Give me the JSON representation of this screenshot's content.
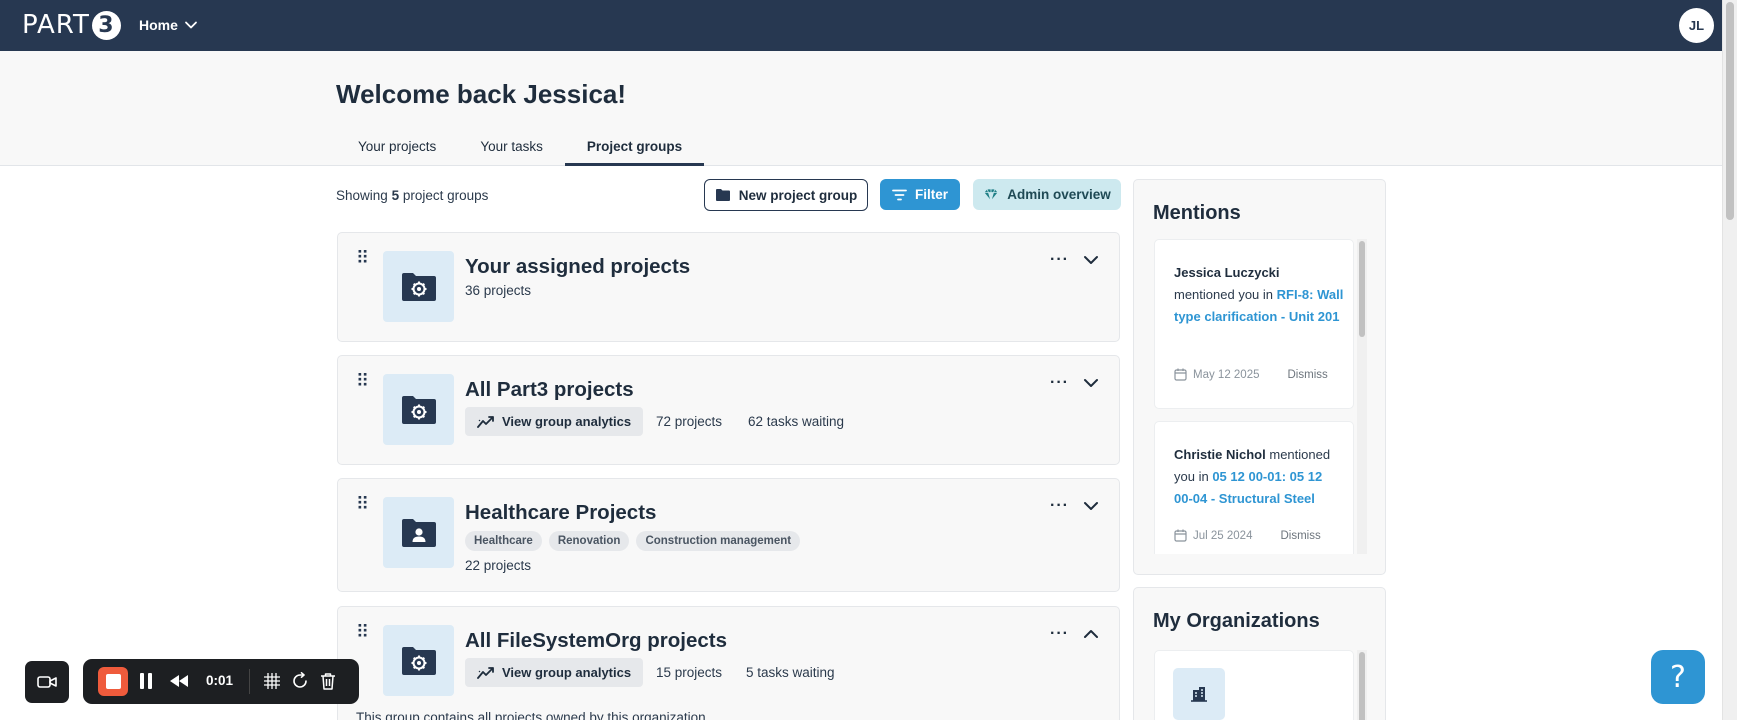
{
  "topbar": {
    "logo_text": "PART",
    "logo_digit": "3",
    "home_label": "Home",
    "avatar_initials": "JL"
  },
  "header": {
    "welcome": "Welcome back Jessica!",
    "tabs": [
      {
        "label": "Your projects",
        "active": false
      },
      {
        "label": "Your tasks",
        "active": false
      },
      {
        "label": "Project groups",
        "active": true
      }
    ]
  },
  "toolbar": {
    "showing_prefix": "Showing",
    "showing_count": "5",
    "showing_suffix": "project groups",
    "new_group_label": "New project group",
    "filter_label": "Filter",
    "admin_label": "Admin overview"
  },
  "groups": [
    {
      "title": "Your assigned projects",
      "projects": "36 projects"
    },
    {
      "title": "All Part3 projects",
      "analytics_label": "View group analytics",
      "projects": "72 projects",
      "tasks": "62 tasks waiting"
    },
    {
      "title": "Healthcare Projects",
      "tags": [
        "Healthcare",
        "Renovation",
        "Construction management"
      ],
      "projects": "22 projects"
    },
    {
      "title": "All FileSystemOrg projects",
      "analytics_label": "View group analytics",
      "projects": "15 projects",
      "tasks": "5 tasks waiting",
      "description": "This group contains all projects owned by this organization."
    }
  ],
  "mentions": {
    "title": "Mentions",
    "items": [
      {
        "who": "Jessica Luczycki",
        "verb": "mentioned you in",
        "link": "RFI-8: Wall type clarification - Unit 201",
        "date": "May 12 2025",
        "dismiss": "Dismiss"
      },
      {
        "who": "Christie Nichol",
        "verb": "mentioned you in",
        "link": "05 12 00-01: 05 12 00-04 - Structural Steel",
        "date": "Jul 25 2024",
        "dismiss": "Dismiss"
      }
    ]
  },
  "organizations": {
    "title": "My Organizations"
  },
  "help": {
    "label": "?"
  },
  "recorder": {
    "time": "0:01"
  },
  "colors": {
    "topbar": "#273851",
    "accent": "#2e95d3",
    "admin_bg": "#cde9ef",
    "record": "#ef5b3c"
  }
}
